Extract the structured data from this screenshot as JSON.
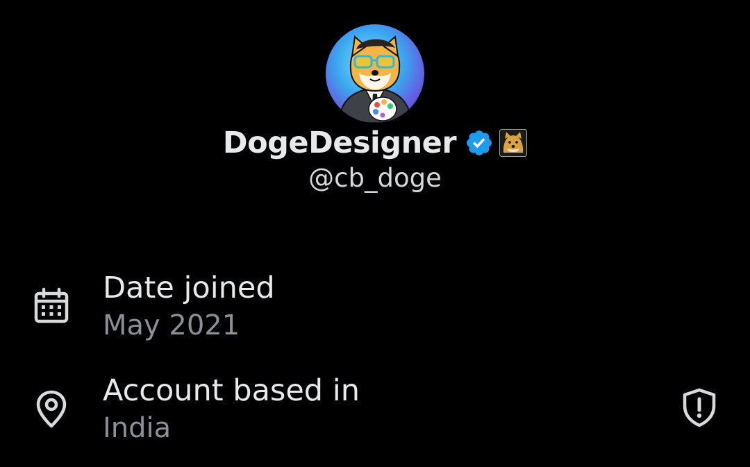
{
  "profile": {
    "display_name": "DogeDesigner",
    "handle": "@cb_doge",
    "verified_badge_color": "#1d9bf0",
    "avatar_icon": "doge-painter-avatar",
    "affiliate_icon": "doge-badge-icon"
  },
  "about": {
    "joined": {
      "icon": "calendar-icon",
      "title": "Date joined",
      "value": "May 2021"
    },
    "location": {
      "icon": "location-pin-icon",
      "title": "Account based in",
      "value": "India",
      "trailing_icon": "shield-alert-icon"
    }
  },
  "colors": {
    "background": "#000000",
    "primary_text": "#e7e9ea",
    "secondary_text": "#8b9096",
    "icon": "#d9dadb"
  }
}
